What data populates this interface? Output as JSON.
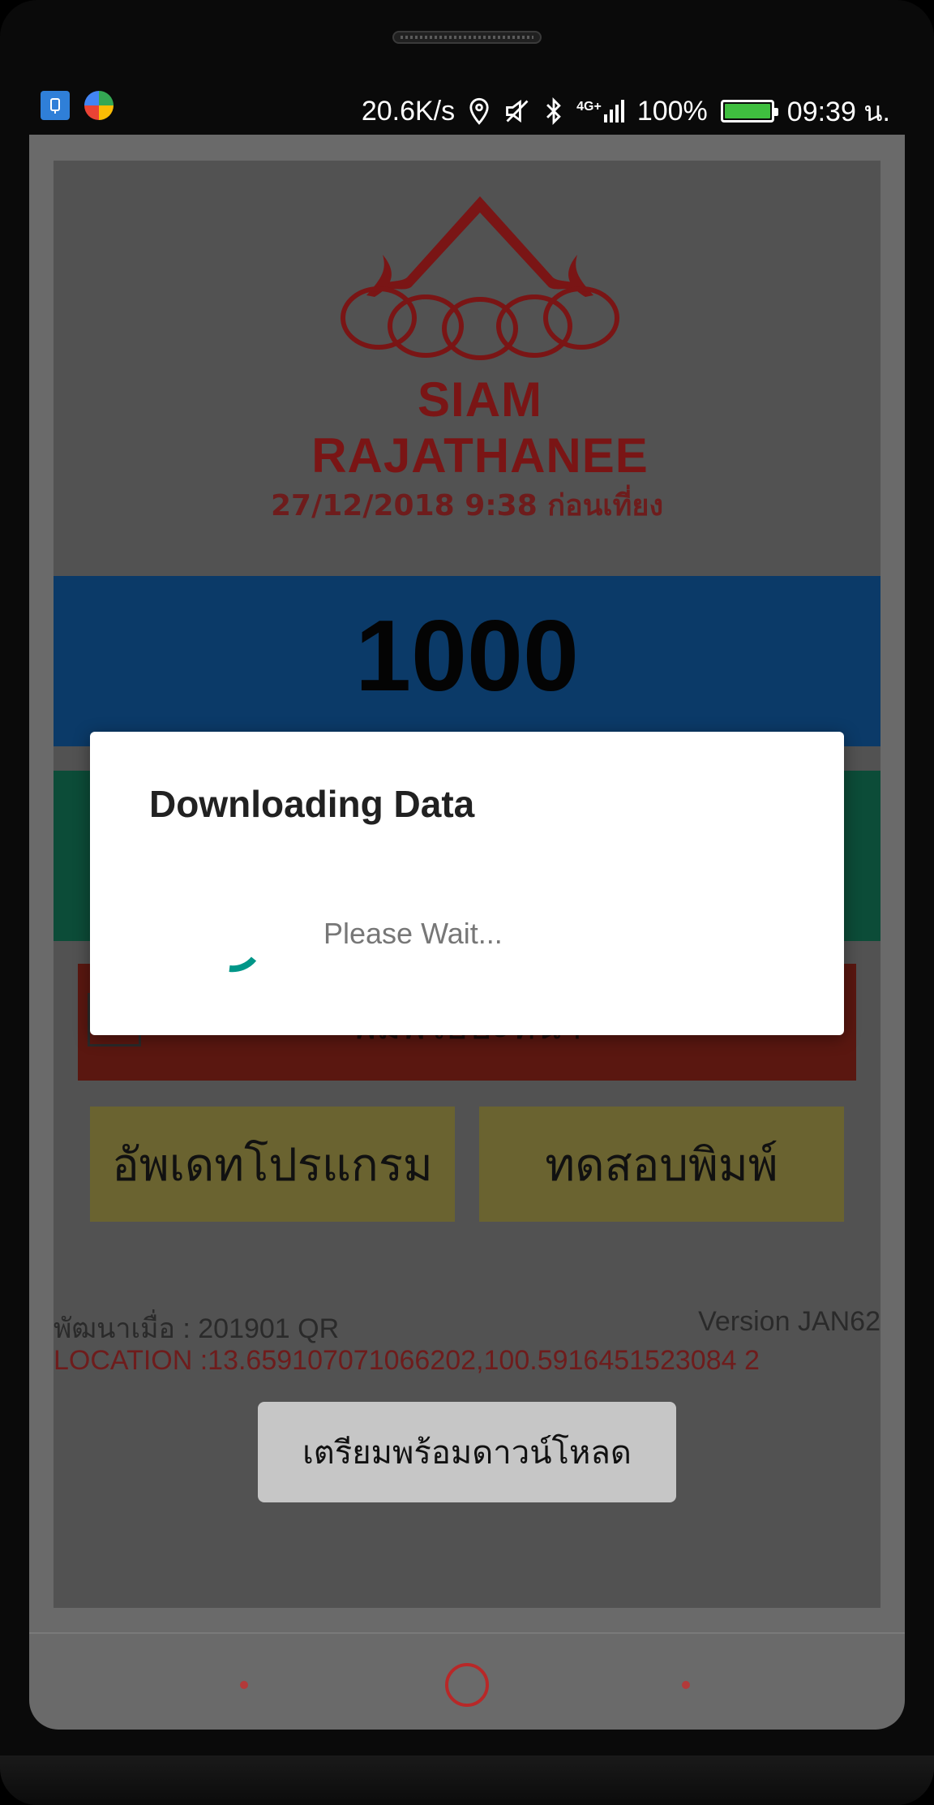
{
  "status_bar": {
    "net_speed": "20.6K/s",
    "network": "4G+",
    "battery": "100%",
    "battery_level": 1.0,
    "time": "09:39 น.",
    "icons": [
      "usb-debug-icon",
      "google-maps-icon",
      "location-icon",
      "mute-icon",
      "bluetooth-icon",
      "signal-icon",
      "battery-icon"
    ]
  },
  "app": {
    "logo_text": "SIAM RAJATHANEE",
    "datetime": "27/12/2018 9:38 ก่อนเที่ยง",
    "counter": "1000",
    "red_button_label": "พิมพ์ใบปะหน้า",
    "update_button": "อัพเดทโปรแกรม",
    "test_print_button": "ทดสอบพิมพ์",
    "dev_info": "พัฒนาเมื่อ : 201901 QR",
    "version": "Version JAN62",
    "location": "LOCATION :13.659107071066202,100.5916451523084 2"
  },
  "toast": {
    "text": "เตรียมพร้อมดาวน์โหลด"
  },
  "dialog": {
    "title": "Downloading Data",
    "message": "Please Wait..."
  },
  "colors": {
    "accent_spinner": "#009688",
    "brand_red": "#8b1a1a",
    "counter_bg": "#0b3a68"
  }
}
